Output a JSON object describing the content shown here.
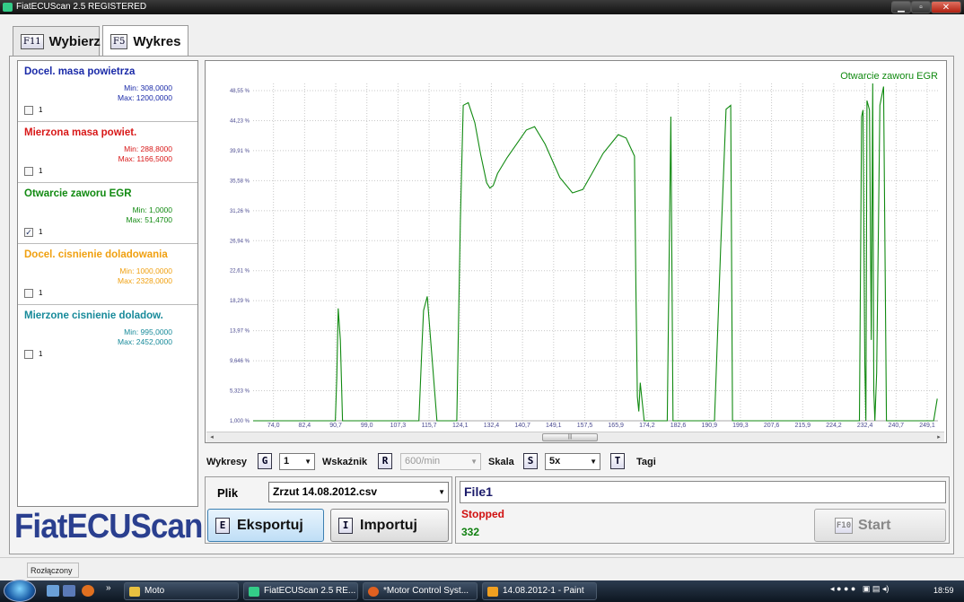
{
  "window": {
    "title": "FiatECUScan 2.5 REGISTERED",
    "buttons": {
      "minimize": "▁",
      "maximize": "▫",
      "close": "✕"
    }
  },
  "tabs": [
    {
      "key": "F11",
      "label": "Wybierz"
    },
    {
      "key": "F5",
      "label": "Wykres"
    }
  ],
  "params": [
    {
      "name": "Docel. masa powietrza",
      "min": "Min: 308,0000",
      "max": "Max: 1200,0000",
      "checked": "",
      "count": "1",
      "color": "#1a2aa8"
    },
    {
      "name": "Mierzona masa powiet.",
      "min": "Min: 288,8000",
      "max": "Max: 1166,5000",
      "checked": "",
      "count": "1",
      "color": "#d81818"
    },
    {
      "name": "Otwarcie zaworu EGR",
      "min": "Min: 1,0000",
      "max": "Max: 51,4700",
      "checked": "✓",
      "count": "1",
      "color": "#118a11"
    },
    {
      "name": "Docel. cisnienie doladowania",
      "min": "Min: 1000,0000",
      "max": "Max: 2328,0000",
      "checked": "",
      "count": "1",
      "color": "#f0a010"
    },
    {
      "name": "Mierzone cisnienie doladow.",
      "min": "Min: 995,0000",
      "max": "Max: 2452,0000",
      "checked": "",
      "count": "1",
      "color": "#178a9a"
    }
  ],
  "chart_data": {
    "type": "line",
    "title": "",
    "legend": "Otwarcie zaworu EGR",
    "legend_position": "top-right",
    "series_color": "#118a11",
    "grid": true,
    "xlabel": "",
    "ylabel": "",
    "xlim": [
      66.5,
      256.5
    ],
    "ylim": [
      1.0,
      51.47
    ],
    "x_ticks": [
      "74,0",
      "82,4",
      "90,7",
      "99,0",
      "107,3",
      "115,7",
      "124,1",
      "132,4",
      "140,7",
      "149,1",
      "157,5",
      "165,9",
      "174,2",
      "182,6",
      "190,9",
      "199,3",
      "207,6",
      "215,9",
      "224,2",
      "232,4",
      "240,7",
      "249,1"
    ],
    "y_ticks": [
      "1,000 %",
      "5,323 %",
      "9,646 %",
      "13,97 %",
      "18,29 %",
      "22,61 %",
      "26,94 %",
      "31,26 %",
      "35,58 %",
      "39,91 %",
      "44,23 %",
      "48,55 %"
    ],
    "x": [
      66.5,
      89.3,
      89.7,
      90.1,
      90.7,
      91.3,
      91.7,
      108.0,
      112.5,
      113.4,
      113.8,
      114.8,
      117.5,
      123.0,
      124.0,
      124.8,
      126.2,
      128.0,
      129.6,
      131.3,
      132.2,
      133.1,
      134.3,
      137.0,
      142.3,
      144.6,
      147.5,
      151.6,
      155.1,
      158.0,
      160.5,
      163.6,
      167.8,
      170.0,
      172.3,
      172.7,
      173.1,
      173.5,
      173.9,
      174.3,
      175.0,
      181.4,
      181.9,
      182.4,
      183.0,
      185.3,
      194.5,
      196.2,
      197.7,
      199.0,
      199.5,
      203.0,
      234.7,
      235.3,
      235.7,
      236.2,
      236.5,
      236.8,
      237.5,
      238.0,
      238.4,
      238.7,
      239.0,
      239.5,
      240.4,
      241.4,
      242.2,
      254.0,
      255.3,
      256.3
    ],
    "y": [
      1.0,
      1.0,
      7.4,
      17.8,
      13.1,
      1.0,
      1.0,
      1.0,
      1.0,
      12.8,
      17.5,
      19.6,
      1.0,
      1.0,
      31.0,
      48.2,
      48.6,
      45.6,
      40.9,
      36.6,
      35.8,
      36.2,
      38.0,
      40.4,
      44.5,
      45.0,
      42.4,
      37.4,
      35.1,
      35.6,
      38.0,
      41.0,
      43.8,
      43.3,
      40.6,
      20.5,
      4.6,
      2.4,
      6.7,
      4.6,
      1.0,
      1.0,
      24.1,
      46.5,
      1.0,
      1.0,
      1.0,
      26.5,
      47.6,
      48.2,
      1.0,
      1.0,
      1.0,
      46.5,
      47.5,
      9.5,
      1.0,
      48.9,
      47.5,
      13.1,
      51.47,
      5.6,
      1.0,
      8.2,
      48.2,
      51.0,
      1.0,
      1.0,
      1.0,
      4.3
    ]
  },
  "controls": {
    "wykresy_label": "Wykresy",
    "wykresy_key": "G",
    "wykresy_value": "1",
    "wskaznik_label": "Wskaźnik",
    "wskaznik_key": "R",
    "wskaznik_value": "600/min",
    "skala_label": "Skala",
    "skala_key": "S",
    "skala_value": "5x",
    "tagi_label": "Tagi",
    "tagi_key": "T"
  },
  "file": {
    "plik_label": "Plik",
    "selected": "Zrzut 14.08.2012.csv",
    "export_key": "E",
    "export_label": "Eksportuj",
    "import_key": "I",
    "import_label": "Importuj"
  },
  "status": {
    "filename": "File1",
    "state": "Stopped",
    "count": "332",
    "start_key": "F10",
    "start_label": "Start"
  },
  "logo": "FiatECUScan",
  "statusbar": {
    "connection": "Rozłączony"
  },
  "taskbar": {
    "items": [
      {
        "label": "Moto",
        "icon_color": "#e8c040"
      },
      {
        "label": "FiatECUScan 2.5 RE...",
        "icon_color": "#3c8"
      },
      {
        "label": "*Motor Control Syst...",
        "icon_color": "#e06020"
      },
      {
        "label": "14.08.2012-1 - Paint",
        "icon_color": "#f0a020"
      }
    ],
    "clock": "18:59"
  }
}
